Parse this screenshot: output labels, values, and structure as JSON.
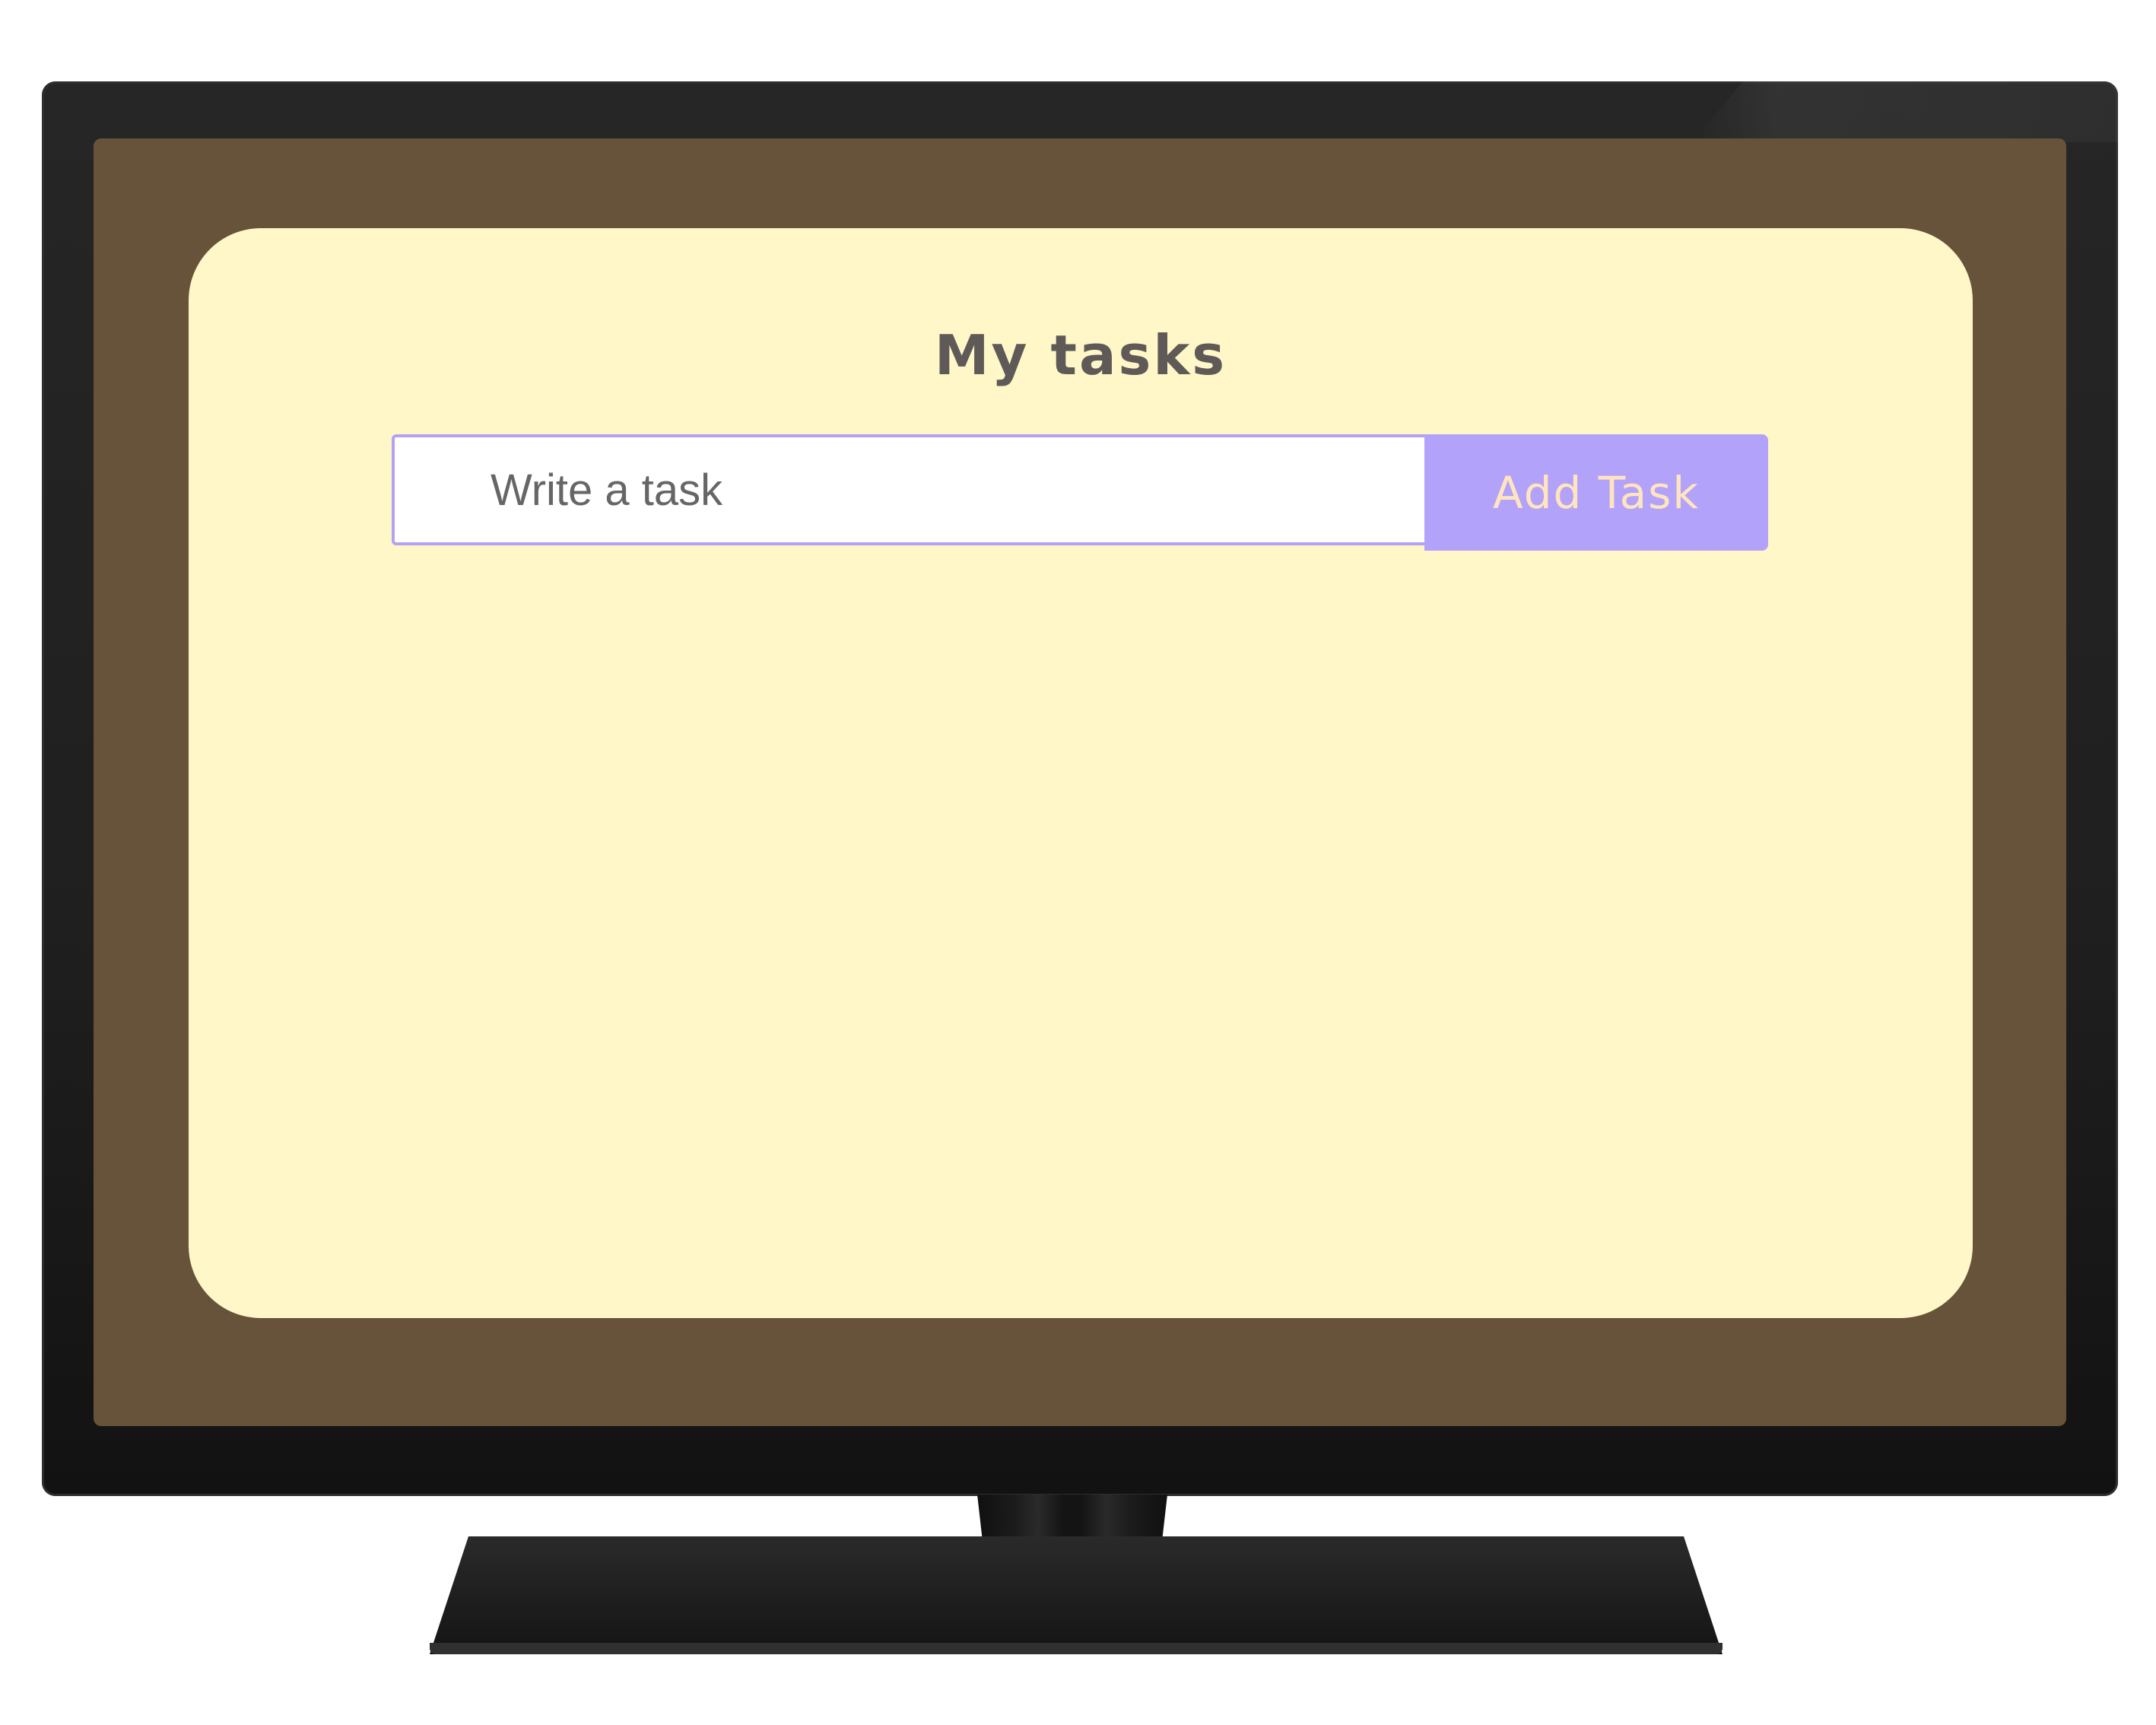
{
  "app": {
    "title": "My tasks"
  },
  "task_form": {
    "input_value": "",
    "input_placeholder": "Write a task",
    "add_button_label": "Add Task"
  },
  "tasks": [],
  "colors": {
    "card_background": "#fff7c7",
    "screen_background": "#67523a",
    "accent": "#b3a2f9",
    "button_text": "#ffe5bf",
    "title_text": "#5f5a57"
  }
}
